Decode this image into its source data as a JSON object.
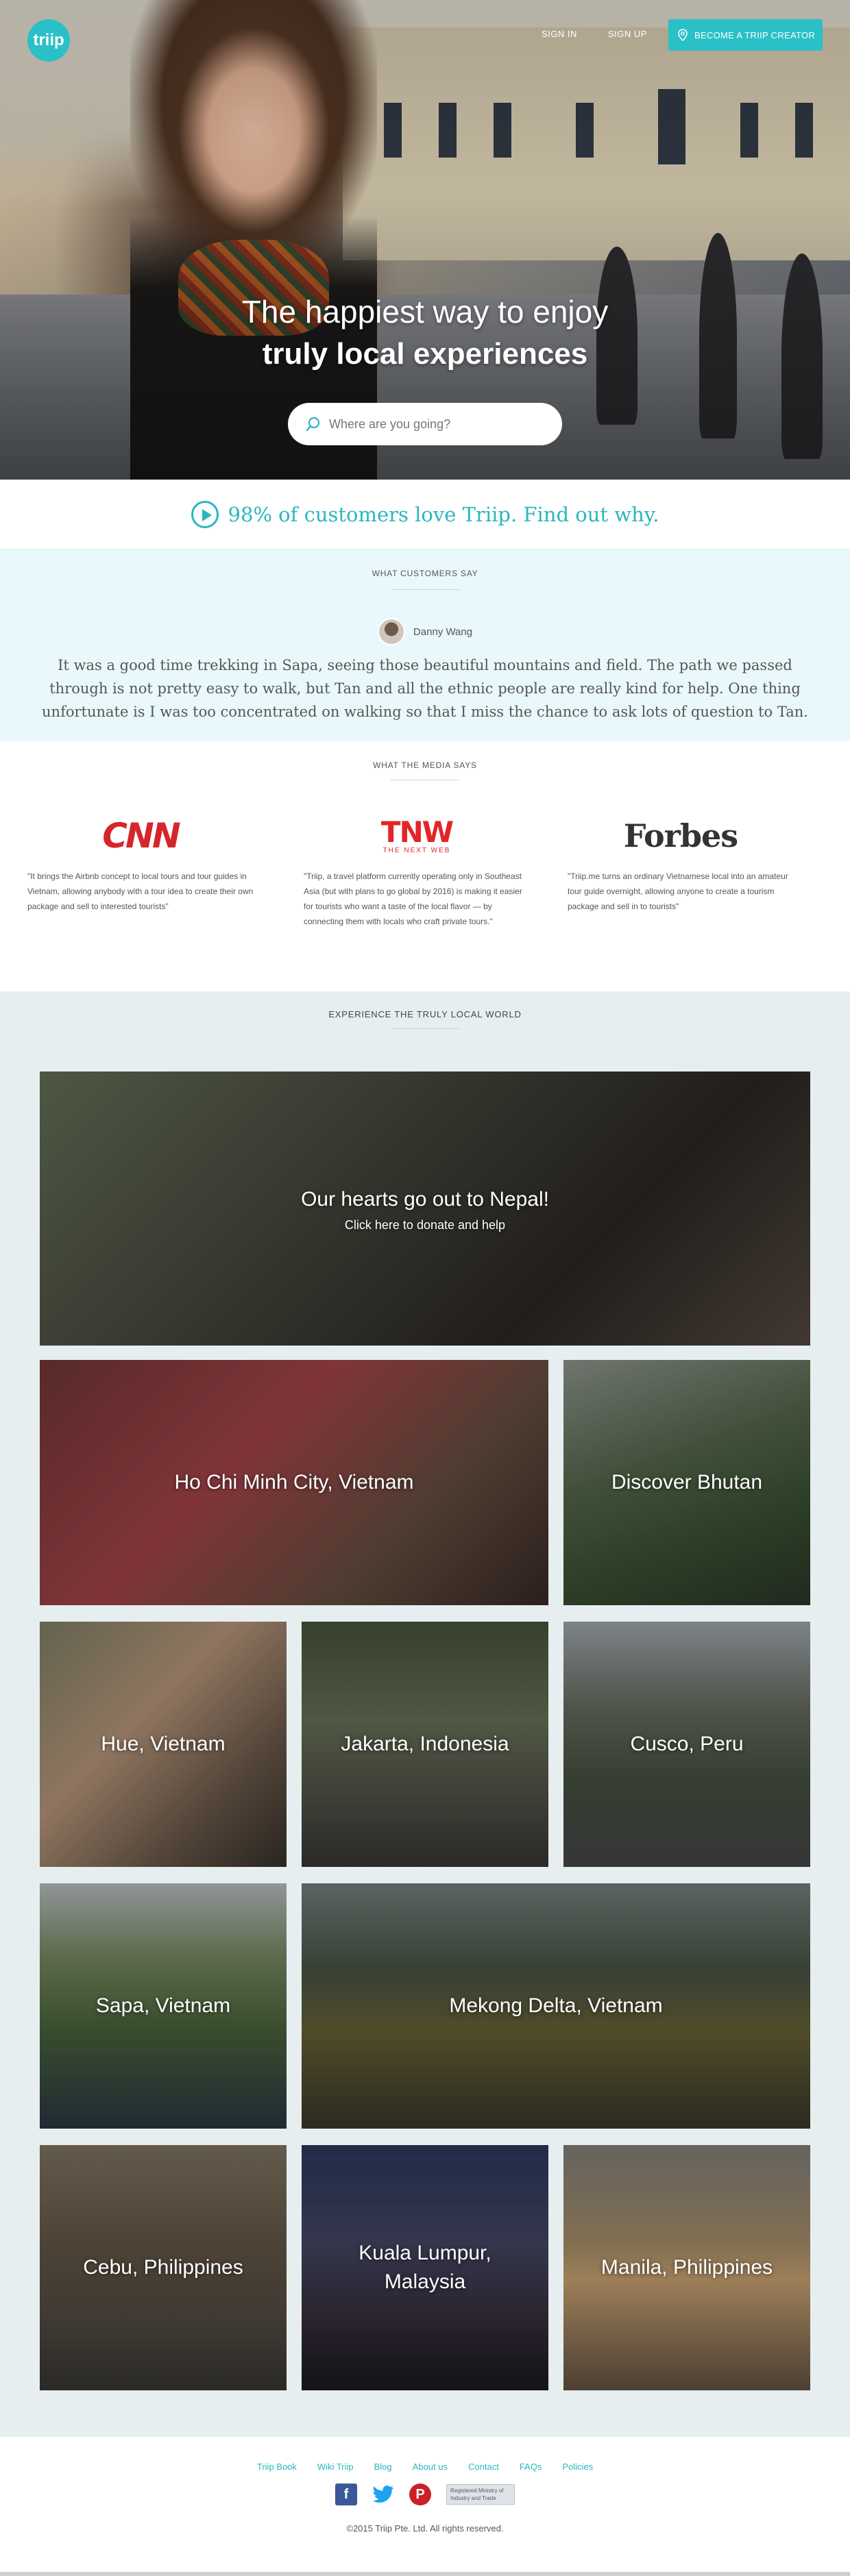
{
  "header": {
    "logo_text": "triip",
    "sign_in": "SIGN IN",
    "sign_up": "SIGN UP",
    "cta": "BECOME A TRIIP CREATOR"
  },
  "hero": {
    "title": "The happiest way to enjoy",
    "subtitle": "truly local experiences",
    "search_placeholder": "Where are you going?"
  },
  "tagline": "98% of customers love Triip. Find out why.",
  "testimonial": {
    "heading": "WHAT CUSTOMERS SAY",
    "author": "Danny Wang",
    "quote": "It was a good time trekking in Sapa, seeing those beautiful mountains and field. The path we passed through is not pretty easy to walk, but Tan and all the ethnic people are really kind for help. One thing unfortunate is I was too concentrated on walking so that I miss the chance to ask lots of question to Tan."
  },
  "media": {
    "heading": "WHAT THE MEDIA SAYS",
    "items": [
      {
        "logo": "CNN",
        "quote": "\"It brings the Airbnb concept to local tours and tour guides in Vietnam, allowing anybody with a tour idea to create their own package and sell to interested tourists\""
      },
      {
        "logo": "TNW",
        "logo_sub": "THE NEXT WEB",
        "quote": "\"Triip, a travel platform currently operating only in Southeast Asia (but with plans to go global by 2016) is making it easier for tourists who want a taste of the local flavor — by connecting them with locals who craft private tours.\""
      },
      {
        "logo": "Forbes",
        "quote": "\"Triip.me turns an ordinary Vietnamese local into an amateur tour guide overnight, allowing anyone to create a tourism package and sell in to tourists\""
      }
    ]
  },
  "experience": {
    "heading": "EXPERIENCE THE TRULY LOCAL WORLD",
    "nepal": {
      "title": "Our hearts go out to Nepal!",
      "sub": "Click here to donate and help"
    },
    "destinations": [
      "Ho Chi Minh City, Vietnam",
      "Discover Bhutan",
      "Hue, Vietnam",
      "Jakarta, Indonesia",
      "Cusco, Peru",
      "Sapa, Vietnam",
      "Mekong Delta, Vietnam",
      "Cebu, Philippines",
      "Kuala Lumpur, Malaysia",
      "Manila, Philippines"
    ]
  },
  "footer": {
    "links": [
      "Triip Book",
      "Wiki Triip",
      "Blog",
      "About us",
      "Contact",
      "FAQs",
      "Policies"
    ],
    "badge_text": "Registered Ministry of Industry and Trade",
    "copyright": "©2015 Triip Pte. Ltd. All rights reserved."
  },
  "colors": {
    "accent": "#2ab7bf",
    "testimonial_bg": "#e9f9fb",
    "experience_bg": "#e6eeef"
  }
}
